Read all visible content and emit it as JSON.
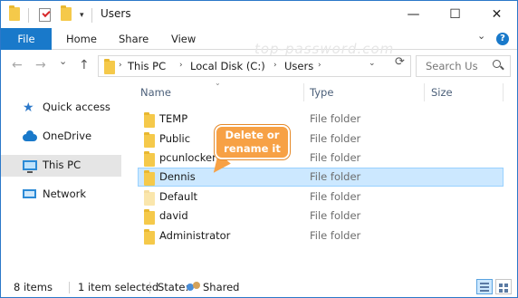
{
  "window": {
    "title": "Users",
    "controls": {
      "minimize": "—",
      "maximize": "☐",
      "close": "✕"
    }
  },
  "quick_access_toolbar": {
    "dropdown": "▾"
  },
  "ribbon": {
    "file_tab": "File",
    "tabs": [
      "Home",
      "Share",
      "View"
    ],
    "collapse": "⌄",
    "help": "?",
    "accent_color": "#1979ca"
  },
  "watermark": "top-password.com",
  "navigation": {
    "back": "←",
    "forward": "→",
    "recent": "⌄",
    "up": "↑",
    "breadcrumb": [
      "This PC",
      "Local Disk (C:)",
      "Users"
    ],
    "crumb_separator": "›",
    "address_dropdown": "⌄",
    "refresh": "⟳",
    "search_placeholder": "Search Us"
  },
  "nav_pane": {
    "items": [
      {
        "label": "Quick access",
        "icon": "star-icon"
      },
      {
        "label": "OneDrive",
        "icon": "cloud-icon"
      },
      {
        "label": "This PC",
        "icon": "monitor-icon",
        "selected": true
      },
      {
        "label": "Network",
        "icon": "network-icon"
      }
    ]
  },
  "columns": {
    "name": "Name",
    "type": "Type",
    "size": "Size",
    "sort_indicator": "⌄"
  },
  "files": [
    {
      "name": "TEMP",
      "type": "File folder"
    },
    {
      "name": "Public",
      "type": "File folder"
    },
    {
      "name": "pcunlocker",
      "type": "File folder"
    },
    {
      "name": "Dennis",
      "type": "File folder",
      "selected": true
    },
    {
      "name": "Default",
      "type": "File folder",
      "hidden": true
    },
    {
      "name": "david",
      "type": "File folder"
    },
    {
      "name": "Administrator",
      "type": "File folder"
    }
  ],
  "callout": {
    "line1": "Delete or",
    "line2": "rename it",
    "color": "#f7a145"
  },
  "status_bar": {
    "item_count": "8 items",
    "selection": "1 item selected",
    "state_label": "State:",
    "state_value": "Shared"
  }
}
